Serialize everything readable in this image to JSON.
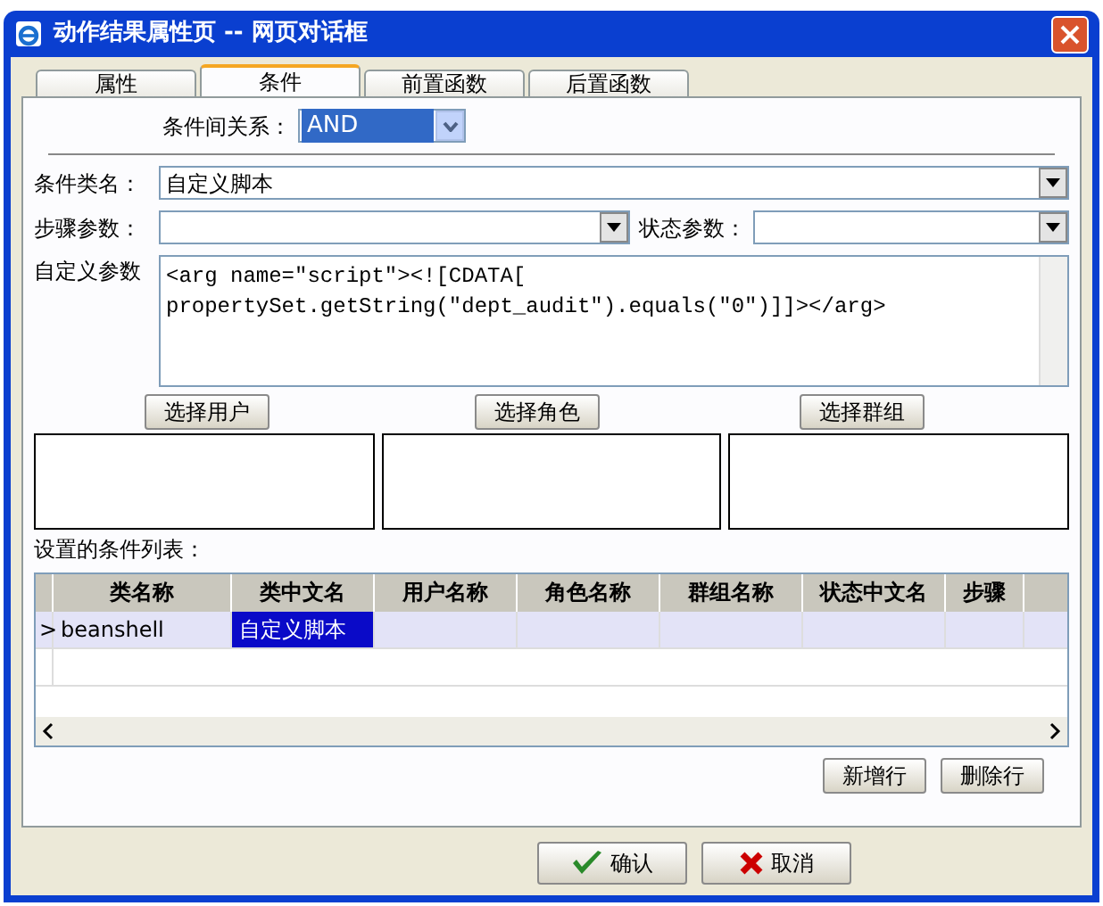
{
  "window": {
    "title": "动作结果属性页 -- 网页对话框"
  },
  "tabs": [
    {
      "label": "属性",
      "selected": false
    },
    {
      "label": "条件",
      "selected": true
    },
    {
      "label": "前置函数",
      "selected": false
    },
    {
      "label": "后置函数",
      "selected": false
    }
  ],
  "relation": {
    "label": "条件间关系：",
    "value": "AND"
  },
  "class_name": {
    "label": "条件类名：",
    "value": "自定义脚本"
  },
  "step_param": {
    "label": "步骤参数："
  },
  "state_param": {
    "label": "状态参数："
  },
  "custom_params": {
    "label": "自定义参数",
    "value": "<arg name=\"script\"><![CDATA[\npropertySet.getString(\"dept_audit\").equals(\"0\")]]></arg>"
  },
  "pick_buttons": [
    "选择用户",
    "选择角色",
    "选择群组"
  ],
  "list_label": "设置的条件列表：",
  "grid": {
    "columns": [
      "类名称",
      "类中文名",
      "用户名称",
      "角色名称",
      "群组名称",
      "状态中文名",
      "步骤"
    ],
    "rows": [
      {
        "marker": ">",
        "selected": true,
        "cells": [
          {
            "text": "beanshell",
            "selected": false
          },
          {
            "text": "自定义脚本",
            "selected": true
          }
        ]
      }
    ]
  },
  "row_buttons": [
    "新增行",
    "删除行"
  ],
  "dialog_buttons": [
    {
      "kind": "ok",
      "label": "确认"
    },
    {
      "kind": "cancel",
      "label": "取消"
    }
  ]
}
